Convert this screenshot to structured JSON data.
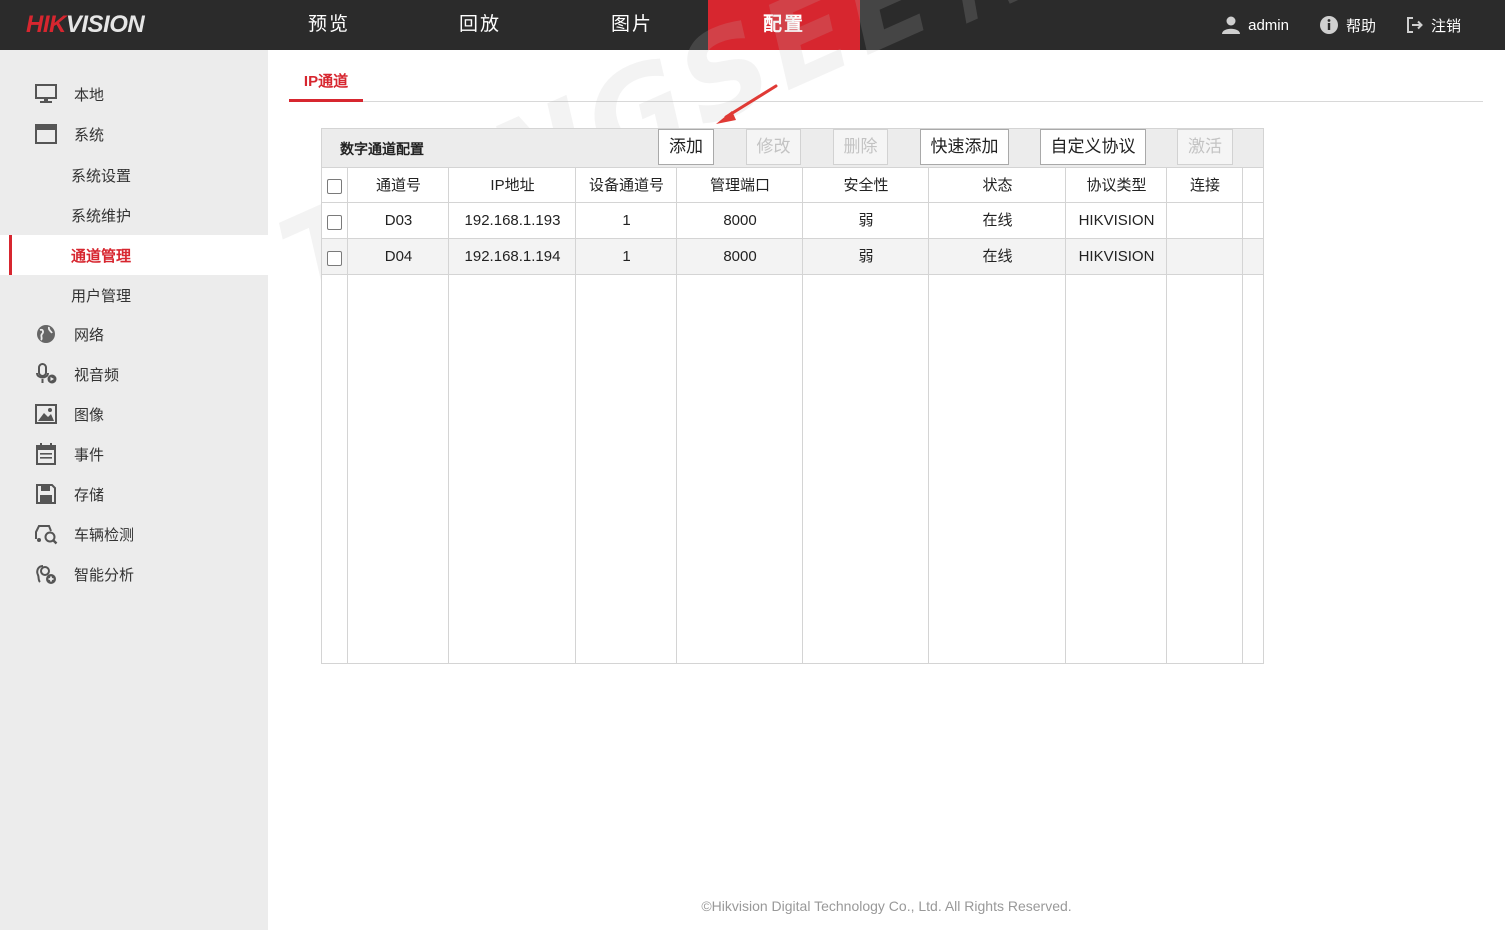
{
  "brand": {
    "hik": "HIK",
    "vision": "VISION"
  },
  "nav": [
    {
      "label": "预览"
    },
    {
      "label": "回放"
    },
    {
      "label": "图片"
    },
    {
      "label": "配置"
    }
  ],
  "top_right": {
    "user": "admin",
    "help": "帮助",
    "logout": "注销"
  },
  "sidebar": {
    "items": [
      {
        "label": "本地",
        "icon": "monitor-icon"
      },
      {
        "label": "系统",
        "icon": "window-icon"
      },
      {
        "label": "网络",
        "icon": "globe-icon"
      },
      {
        "label": "视音频",
        "icon": "microphone-icon"
      },
      {
        "label": "图像",
        "icon": "image-icon"
      },
      {
        "label": "事件",
        "icon": "calendar-icon"
      },
      {
        "label": "存储",
        "icon": "floppy-icon"
      },
      {
        "label": "车辆检测",
        "icon": "vehicle-search-icon"
      },
      {
        "label": "智能分析",
        "icon": "smart-analysis-icon"
      }
    ],
    "subitems": [
      {
        "label": "系统设置"
      },
      {
        "label": "系统维护"
      },
      {
        "label": "通道管理",
        "active": true
      },
      {
        "label": "用户管理"
      }
    ]
  },
  "tab": {
    "label": "IP通道"
  },
  "toolbar": {
    "title": "数字通道配置",
    "add": "添加",
    "modify": "修改",
    "delete": "删除",
    "quick_add": "快速添加",
    "custom_protocol": "自定义协议",
    "activate": "激活"
  },
  "table": {
    "headers": [
      "通道号",
      "IP地址",
      "设备通道号",
      "管理端口",
      "安全性",
      "状态",
      "协议类型",
      "连接"
    ],
    "rows": [
      [
        "D03",
        "192.168.1.193",
        "1",
        "8000",
        "弱",
        "在线",
        "HIKVISION",
        ""
      ],
      [
        "D04",
        "192.168.1.194",
        "1",
        "8000",
        "弱",
        "在线",
        "HIKVISION",
        ""
      ]
    ]
  },
  "watermark": "TSINGSEE青犀视频",
  "footer": "©Hikvision Digital Technology Co., Ltd. All Rights Reserved.",
  "colors": {
    "accent": "#d7262f",
    "topbar": "#2b2b2b",
    "sidebar": "#ececec"
  }
}
